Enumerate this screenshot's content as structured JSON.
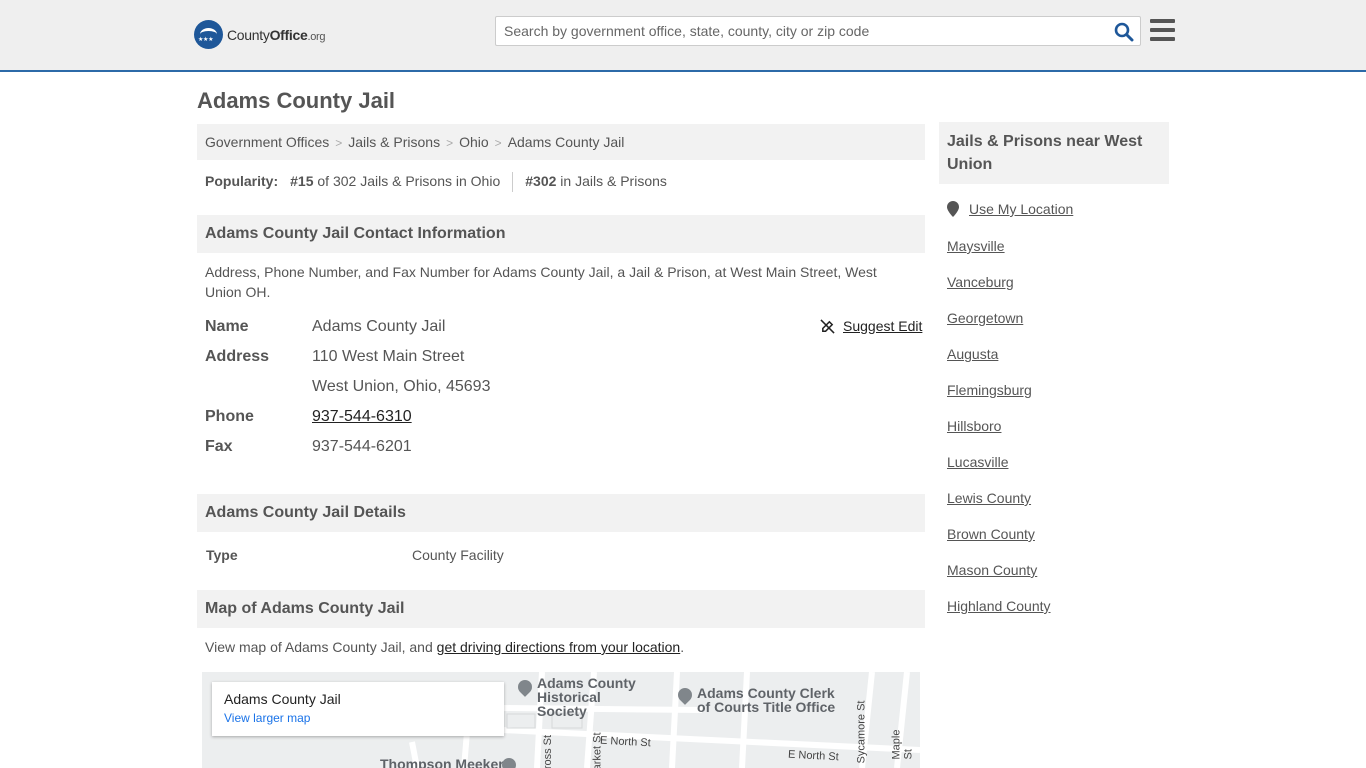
{
  "header": {
    "logo": {
      "part1": "County",
      "part2": "Office",
      "part3": ".org"
    },
    "search_placeholder": "Search by government office, state, county, city or zip code"
  },
  "page": {
    "title": "Adams County Jail",
    "breadcrumb": [
      "Government Offices",
      "Jails & Prisons",
      "Ohio",
      "Adams County Jail"
    ],
    "popularity": {
      "label": "Popularity:",
      "rank_state": "#15",
      "rank_state_text": "of 302 Jails & Prisons in Ohio",
      "rank_all": "#302",
      "rank_all_text": "in Jails & Prisons"
    }
  },
  "contact": {
    "heading": "Adams County Jail Contact Information",
    "description": "Address, Phone Number, and Fax Number for Adams County Jail, a Jail & Prison, at West Main Street, West Union OH.",
    "suggest_edit": "Suggest Edit",
    "name_label": "Name",
    "name": "Adams County Jail",
    "address_label": "Address",
    "address_line1": "110 West Main Street",
    "address_line2": "West Union, Ohio, 45693",
    "phone_label": "Phone",
    "phone": "937-544-6310",
    "fax_label": "Fax",
    "fax": "937-544-6201"
  },
  "details": {
    "heading": "Adams County Jail Details",
    "type_label": "Type",
    "type": "County Facility"
  },
  "map": {
    "heading": "Map of Adams County Jail",
    "intro": "View map of Adams County Jail, and ",
    "directions_link": "get driving directions from your location",
    "intro_end": ".",
    "card_title": "Adams County Jail",
    "card_link": "View larger map",
    "labels": [
      "Adams County Historical Society",
      "Adams County Clerk of Courts Title Office",
      "Thompson Meeker"
    ],
    "streets": [
      "E North St",
      "E North St",
      "Cross St",
      "Market St",
      "Sycamore St",
      "Maple St"
    ]
  },
  "sidebar": {
    "heading": "Jails & Prisons near West Union",
    "use_location": "Use My Location",
    "links": [
      "Maysville",
      "Vanceburg",
      "Georgetown",
      "Augusta",
      "Flemingsburg",
      "Hillsboro",
      "Lucasville",
      "Lewis County",
      "Brown County",
      "Mason County",
      "Highland County"
    ]
  },
  "colors": {
    "accent": "#2c6aa8",
    "logo": "#1e5799",
    "section_bg": "#f2f2f2"
  }
}
